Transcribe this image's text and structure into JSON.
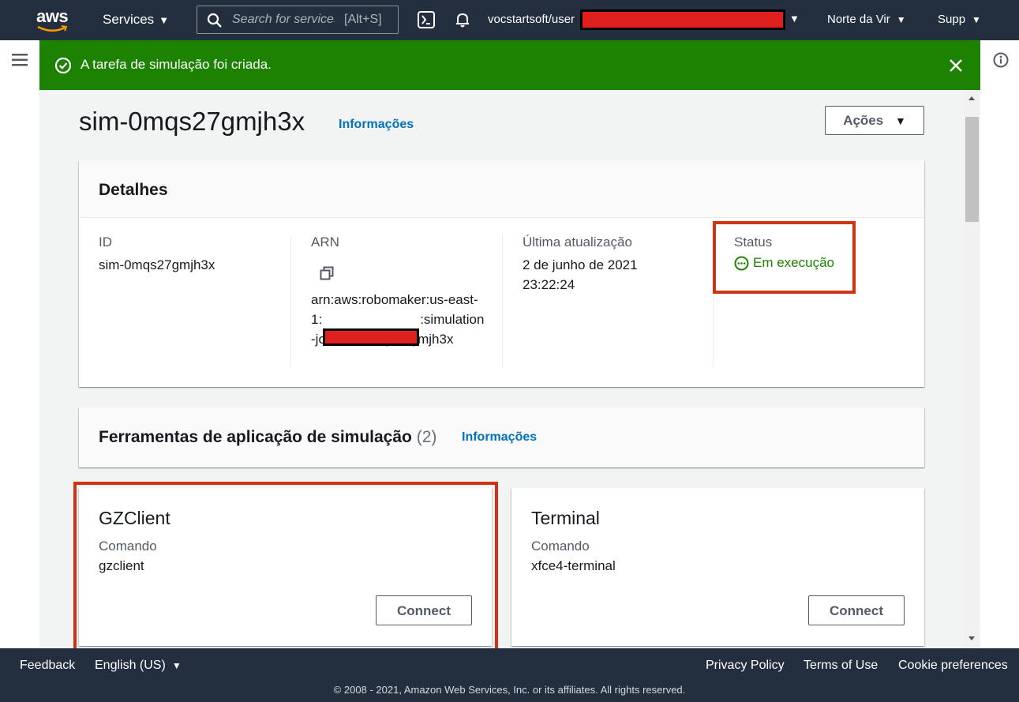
{
  "topnav": {
    "logo_text": "aws",
    "services_label": "Services",
    "search_placeholder": "Search for services",
    "search_shortcut": "[Alt+S]",
    "account_label": "vocstartsoft/user",
    "region_label": "Norte da Vir",
    "support_label": "Supp"
  },
  "flash": {
    "message": "A tarefa de simulação foi criada.",
    "type": "success",
    "color": "#1d8102"
  },
  "page": {
    "title": "sim-0mqs27gmjh3x",
    "info_link": "Informações",
    "actions_button": "Ações"
  },
  "details": {
    "title": "Detalhes",
    "id_label": "ID",
    "id_value": "sim-0mqs27gmjh3x",
    "arn_label": "ARN",
    "arn_prefix": "arn:aws:robomaker:us-east-1:",
    "arn_suffix": ":simulation-job/sim-0mqs27gmjh3x",
    "updated_label": "Última atualização",
    "updated_date": "2 de junho de 2021",
    "updated_time": "23:22:24",
    "status_label": "Status",
    "status_value": "Em execução",
    "status_color": "#1d8102"
  },
  "tools": {
    "title": "Ferramentas de aplicação de simulação",
    "count": "(2)",
    "info_link": "Informações",
    "items": [
      {
        "name": "GZClient",
        "command_label": "Comando",
        "command": "gzclient",
        "connect_label": "Connect"
      },
      {
        "name": "Terminal",
        "command_label": "Comando",
        "command": "xfce4-terminal",
        "connect_label": "Connect"
      }
    ]
  },
  "footer": {
    "feedback": "Feedback",
    "language": "English (US)",
    "privacy": "Privacy Policy",
    "terms": "Terms of Use",
    "cookies": "Cookie preferences",
    "copyright": "© 2008 - 2021, Amazon Web Services, Inc. or its affiliates. All rights reserved."
  },
  "annotations": {
    "highlight_color": "#d13212",
    "redaction_color": "#e0201f"
  }
}
